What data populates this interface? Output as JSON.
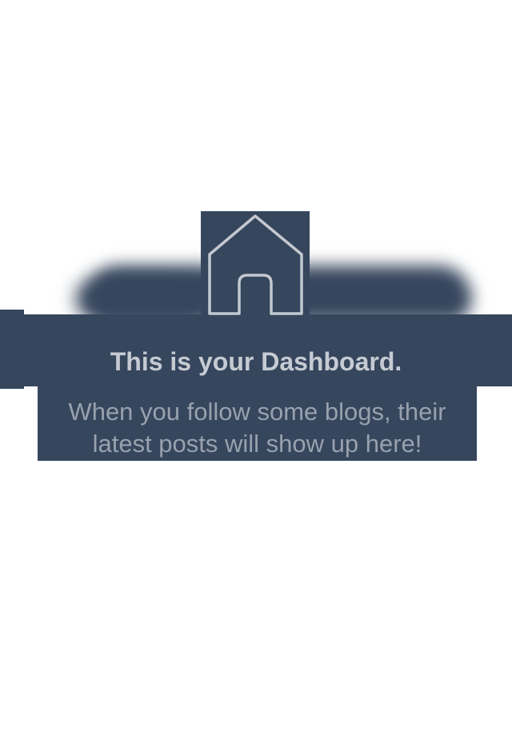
{
  "dashboard": {
    "empty_state": {
      "icon": "home-icon",
      "title": "This is your Dashboard.",
      "message": "When you follow some blogs, their latest posts will show up here!"
    }
  },
  "colors": {
    "background": "#ffffff",
    "panel": "#36465d",
    "title_text": "#c6cbd3",
    "body_text": "#98a1ae",
    "icon_stroke": "#c4c9d1"
  }
}
